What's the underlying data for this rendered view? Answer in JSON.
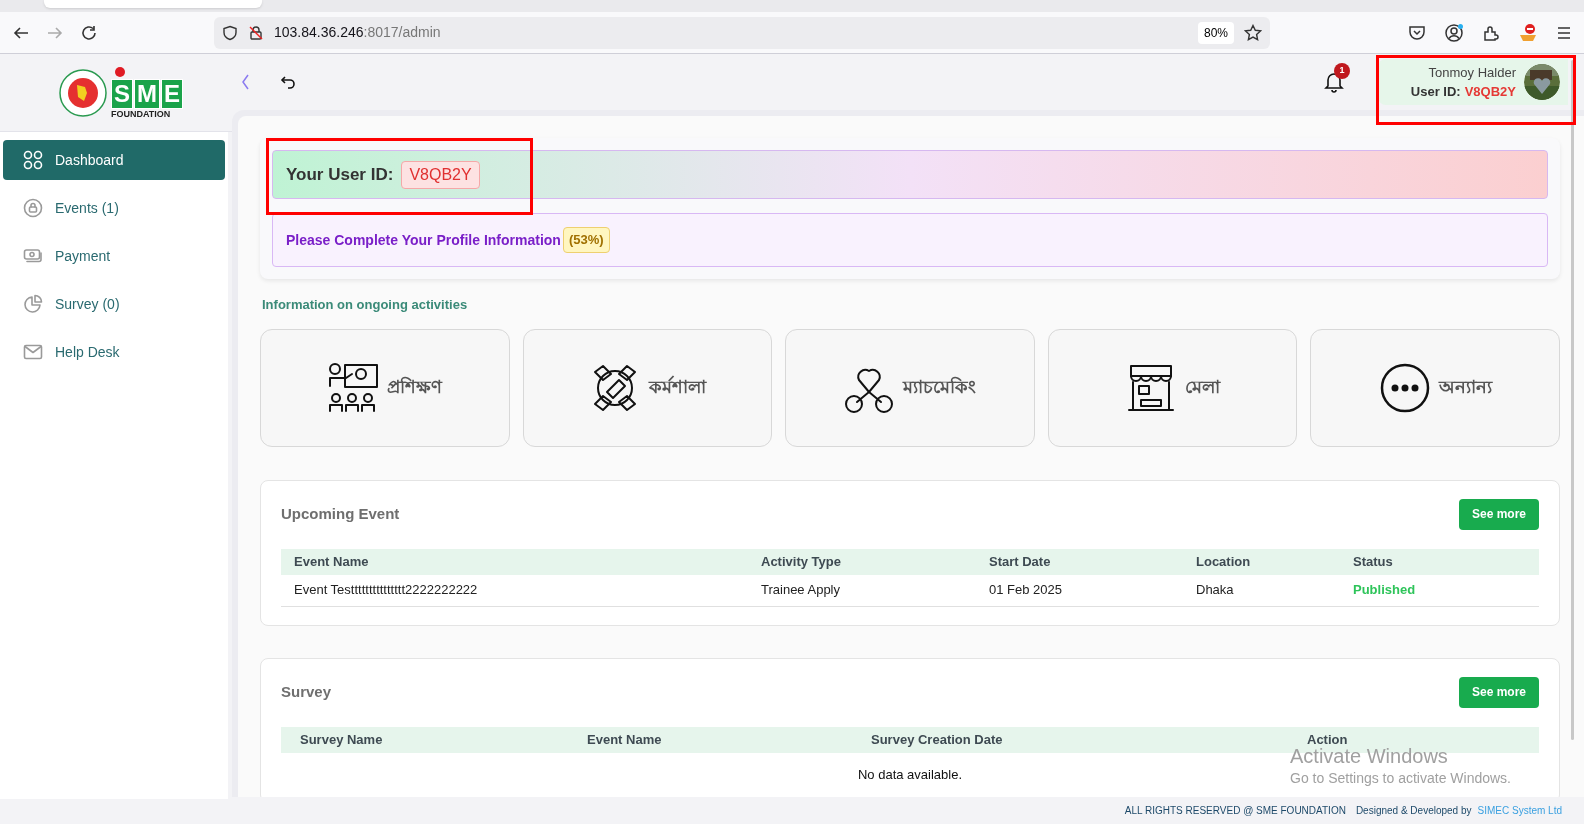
{
  "browser": {
    "url_host": "103.84.36.246",
    "url_rest": ":8017/admin",
    "zoom": "80%"
  },
  "logo": {
    "letters": [
      "S",
      "M",
      "E"
    ],
    "subtitle": "FOUNDATION"
  },
  "sidebar": {
    "items": [
      {
        "label": "Dashboard",
        "kind": "grid",
        "selected": true
      },
      {
        "label": "Events (1)",
        "kind": "lock",
        "selected": false
      },
      {
        "label": "Payment",
        "kind": "cash",
        "selected": false
      },
      {
        "label": "Survey (0)",
        "kind": "pie",
        "selected": false
      },
      {
        "label": "Help Desk",
        "kind": "mail",
        "selected": false
      }
    ]
  },
  "header": {
    "notification_count": "1",
    "user_name": "Tonmoy Halder",
    "user_id_label": "User ID:",
    "user_id": "V8QB2Y",
    "highlighted": true
  },
  "user_id_banner": {
    "label": "Your User ID:",
    "value": "V8QB2Y",
    "highlighted": true
  },
  "profile_notice": {
    "text": "Please Complete Your Profile Information",
    "percent": "(53%)"
  },
  "activities": {
    "title": "Information on ongoing activities",
    "cards": [
      {
        "label": "প্রশিক্ষণ",
        "kind": "training"
      },
      {
        "label": "কর্মশালা",
        "kind": "workshop"
      },
      {
        "label": "ম্যাচমেকিং",
        "kind": "matchmaking"
      },
      {
        "label": "মেলা",
        "kind": "fair"
      },
      {
        "label": "অন্যান্য",
        "kind": "more"
      }
    ]
  },
  "upcoming_event": {
    "title": "Upcoming Event",
    "button": "See more",
    "columns": [
      "Event Name",
      "Activity Type",
      "Start Date",
      "Location",
      "Status"
    ],
    "rows": [
      {
        "cells": [
          "Event Testtttttttttttttt2222222222",
          "Trainee Apply",
          "01 Feb 2025",
          "Dhaka",
          "Published"
        ]
      }
    ]
  },
  "survey": {
    "title": "Survey",
    "button": "See more",
    "columns": [
      "Survey Name",
      "Event Name",
      "Survey Creation Date",
      "Action"
    ],
    "empty_text": "No data available."
  },
  "footer": {
    "rights": "ALL RIGHTS RESERVED @ SME FOUNDATION",
    "credit": "Designed & Developed by",
    "company": "SIMEC System Ltd"
  },
  "os_notice": {
    "title": "Activate Windows",
    "subtitle": "Go to Settings to activate Windows."
  }
}
